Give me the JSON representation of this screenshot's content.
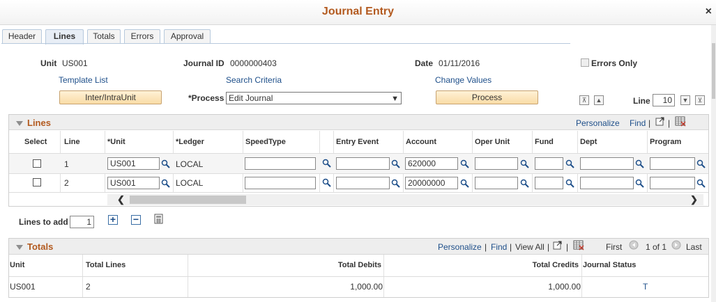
{
  "window": {
    "title": "Journal Entry",
    "close_label": "×"
  },
  "tabs": [
    {
      "label": "Header"
    },
    {
      "label": "Lines"
    },
    {
      "label": "Totals"
    },
    {
      "label": "Errors"
    },
    {
      "label": "Approval"
    }
  ],
  "header": {
    "unit_label": "Unit",
    "unit_value": "US001",
    "journal_label": "Journal ID",
    "journal_value": "0000000403",
    "date_label": "Date",
    "date_value": "01/11/2016",
    "errors_only_label": "Errors Only",
    "template_list": "Template List",
    "search_criteria": "Search Criteria",
    "change_values": "Change Values",
    "inter_intra_btn": "Inter/IntraUnit",
    "process_label": "*Process",
    "process_value": "Edit Journal",
    "process_btn": "Process",
    "line_label": "Line",
    "line_value": "10"
  },
  "lines_grid": {
    "title": "Lines",
    "personalize": "Personalize",
    "find": "Find",
    "sep": "|",
    "columns": [
      "Select",
      "Line",
      "*Unit",
      "*Ledger",
      "SpeedType",
      "Entry Event",
      "Account",
      "Oper Unit",
      "Fund",
      "Dept",
      "Program"
    ],
    "rows": [
      {
        "line": "1",
        "unit": "US001",
        "ledger": "LOCAL",
        "account": "620000"
      },
      {
        "line": "2",
        "unit": "US001",
        "ledger": "LOCAL",
        "account": "20000000"
      }
    ]
  },
  "lines_to_add": {
    "label": "Lines to add",
    "value": "1"
  },
  "totals_grid": {
    "title": "Totals",
    "personalize": "Personalize",
    "find": "Find",
    "view_all": "View All",
    "first": "First",
    "page": "1 of 1",
    "last": "Last",
    "columns": [
      "Unit",
      "Total Lines",
      "Total Debits",
      "Total Credits",
      "Journal Status"
    ],
    "row": {
      "unit": "US001",
      "total_lines": "2",
      "total_debits": "1,000.00",
      "total_credits": "1,000.00",
      "status": "T"
    }
  },
  "colors": {
    "title": "#b35a1f",
    "link": "#1e4f8a",
    "button": "#f9dca6"
  }
}
